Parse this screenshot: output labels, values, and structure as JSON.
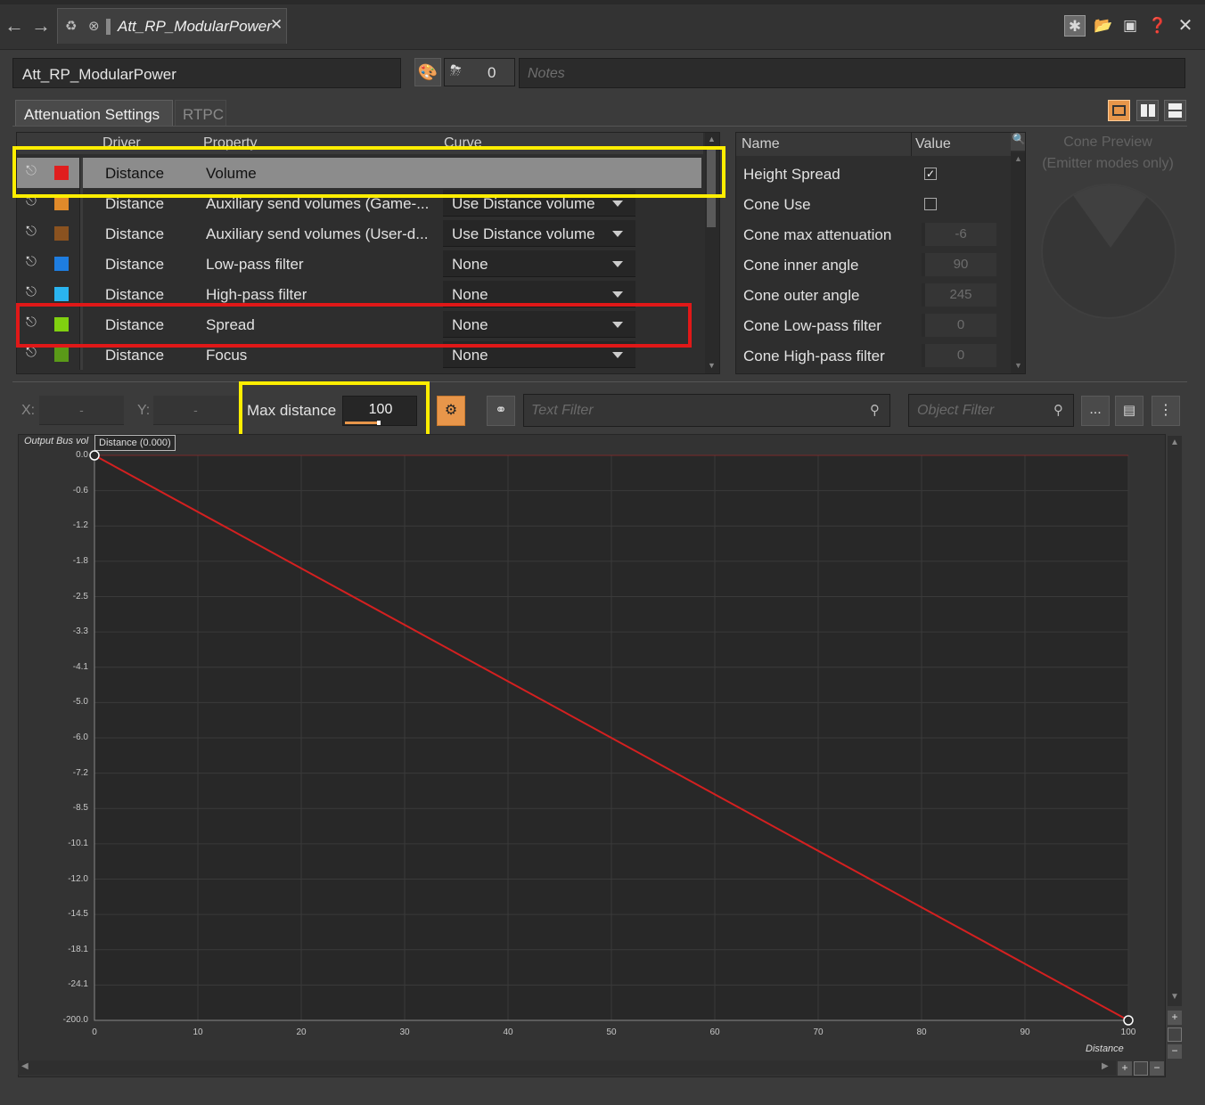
{
  "window": {
    "tab_title": "Att_RP_ModularPower"
  },
  "object": {
    "name": "Att_RP_ModularPower",
    "refs_count": "0",
    "notes_placeholder": "Notes"
  },
  "tabs": [
    {
      "label": "Attenuation Settings"
    },
    {
      "label": "RTPC"
    }
  ],
  "curve_table": {
    "columns": {
      "driver": "Driver",
      "property": "Property",
      "curve": "Curve"
    },
    "rows": [
      {
        "driver": "Distance",
        "property": "Volume",
        "curve": "",
        "color": "#e01e1e"
      },
      {
        "driver": "Distance",
        "property": "Auxiliary send volumes (Game-...",
        "curve": "Use Distance volume",
        "color": "#e08a2a"
      },
      {
        "driver": "Distance",
        "property": "Auxiliary send volumes (User-d...",
        "curve": "Use Distance volume",
        "color": "#8a5220"
      },
      {
        "driver": "Distance",
        "property": "Low-pass filter",
        "curve": "None",
        "color": "#1e7de0"
      },
      {
        "driver": "Distance",
        "property": "High-pass filter",
        "curve": "None",
        "color": "#2ab4f0"
      },
      {
        "driver": "Distance",
        "property": "Spread",
        "curve": "None",
        "color": "#80d010"
      },
      {
        "driver": "Distance",
        "property": "Focus",
        "curve": "None",
        "color": "#5a9a18"
      }
    ]
  },
  "properties": {
    "columns": {
      "name": "Name",
      "value": "Value"
    },
    "rows": [
      {
        "name": "Height Spread",
        "value": "checked"
      },
      {
        "name": "Cone Use",
        "value": "unchecked"
      },
      {
        "name": "Cone max attenuation",
        "value": "-6"
      },
      {
        "name": "Cone inner angle",
        "value": "90"
      },
      {
        "name": "Cone outer angle",
        "value": "245"
      },
      {
        "name": "Cone Low-pass filter",
        "value": "0"
      },
      {
        "name": "Cone High-pass filter",
        "value": "0"
      }
    ]
  },
  "cone_preview": {
    "line1": "Cone Preview",
    "line2": "(Emitter modes only)"
  },
  "toolbar": {
    "x_label": "X:",
    "x_value": "-",
    "y_label": "Y:",
    "y_value": "-",
    "max_distance_label": "Max distance",
    "max_distance_value": "100",
    "text_filter_placeholder": "Text Filter",
    "object_filter_placeholder": "Object Filter",
    "more_label": "..."
  },
  "graph": {
    "y_axis_title": "Output Bus vol",
    "tooltip": "Distance (0.000)",
    "x_axis_title": "Distance"
  },
  "chart_data": {
    "type": "line",
    "xlabel": "Distance",
    "ylabel": "Output Bus vol",
    "x_ticks": [
      "0",
      "10",
      "20",
      "30",
      "40",
      "50",
      "60",
      "70",
      "80",
      "90",
      "100"
    ],
    "y_ticks": [
      "0.0",
      "-0.6",
      "-1.2",
      "-1.8",
      "-2.5",
      "-3.3",
      "-4.1",
      "-5.0",
      "-6.0",
      "-7.2",
      "-8.5",
      "-10.1",
      "-12.0",
      "-14.5",
      "-18.1",
      "-24.1",
      "-200.0"
    ],
    "xlim": [
      0,
      100
    ],
    "grid": true,
    "series": [
      {
        "name": "Volume",
        "color": "#d42020",
        "points": [
          {
            "x": 0,
            "y": 0.0
          },
          {
            "x": 100,
            "y": -200.0
          }
        ]
      }
    ]
  },
  "colors": {
    "highlight_yellow": "#ffee00",
    "highlight_red": "#e01818",
    "accent_orange": "#e8964a"
  }
}
